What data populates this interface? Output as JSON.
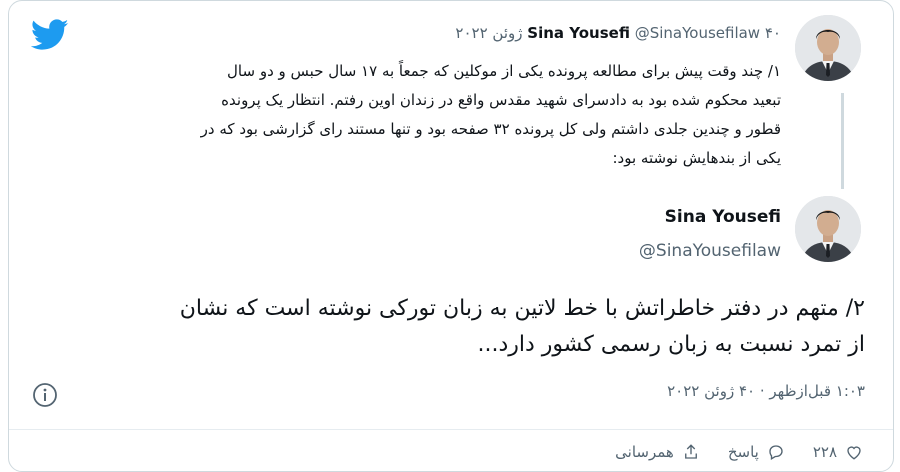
{
  "tweet1": {
    "name": "Sina Yousefi",
    "handle": "@SinaYousefilaw",
    "date": "۴۰ ژوئن ۲۰۲۲",
    "lines": [
      "۱/ چند وقت پیش برای مطالعه پرونده یکی از موکلین که جمعاً به ۱۷ سال حبس و دو سال",
      "تبعید محکوم شده بود به دادسرای شهید مقدس واقع در زندان اوین رفتم. انتظار یک پرونده",
      "قطور و چندین جلدی داشتم ولی کل پرونده ۳۲ صفحه بود و تنها مستند رای گزارشی بود که در",
      "یکی از بندهایش نوشته بود:"
    ]
  },
  "tweet2": {
    "name": "Sina Yousefi",
    "handle": "@SinaYousefilaw",
    "lines": [
      "۲/ متهم در دفتر خاطراتش با خط لاتین به زبان تورکی نوشته است که نشان",
      "از تمرد نسبت به زبان رسمی کشور دارد..."
    ],
    "timestamp": "۱:۰۳ قبل‌ازظهر · ۴۰ ژوئن ۲۰۲۲"
  },
  "actions": {
    "like_count": "۲۲۸",
    "reply_label": "پاسخ",
    "share_label": "همرسانی"
  },
  "icons": {
    "logo": "twitter-bird-icon",
    "info": "info-icon"
  },
  "colors": {
    "brand": "#1d9bf0",
    "text": "#0f1419",
    "muted": "#536471",
    "border": "#cfd9de"
  }
}
